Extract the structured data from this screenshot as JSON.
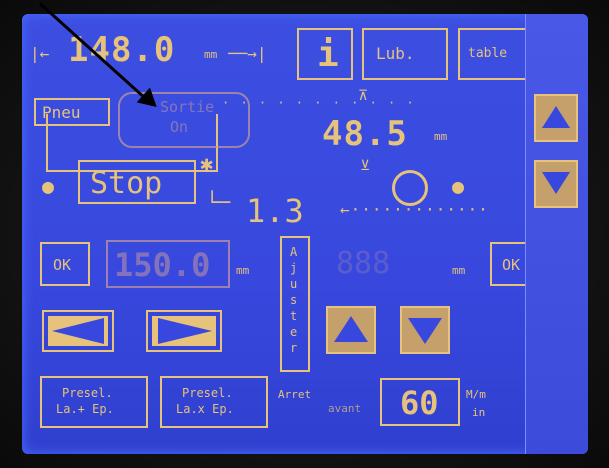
{
  "top": {
    "width_value": "148.0",
    "width_unit": "mm",
    "info_label": "i",
    "lub_label": "Lub.",
    "table_label": "table"
  },
  "left_panel": {
    "pneu_label": "Pneu",
    "sortie_label": "Sortie",
    "on_label": "On",
    "stop_label": "Stop"
  },
  "measures": {
    "height_value": "48.5",
    "height_unit": "mm",
    "gap_value": "1.3"
  },
  "row_ok": {
    "ok_left_label": "OK",
    "value_left": "150.0",
    "value_left_unit": "mm",
    "ajuster_label": "Ajuster",
    "value_right_unit": "mm",
    "ok_right_label": "OK"
  },
  "bottom": {
    "presel_1_line1": "Presel.",
    "presel_1_line2": "La.+ Ep.",
    "presel_2_line1": "Presel.",
    "presel_2_line2": "La.x Ep.",
    "arret_line1": "Arret",
    "arret_line2": "avant",
    "speed_value": "60",
    "speed_unit_line1": "M/m",
    "speed_unit_line2": "in"
  },
  "colors": {
    "screen": "#3848de",
    "accent": "#e6c27a"
  }
}
